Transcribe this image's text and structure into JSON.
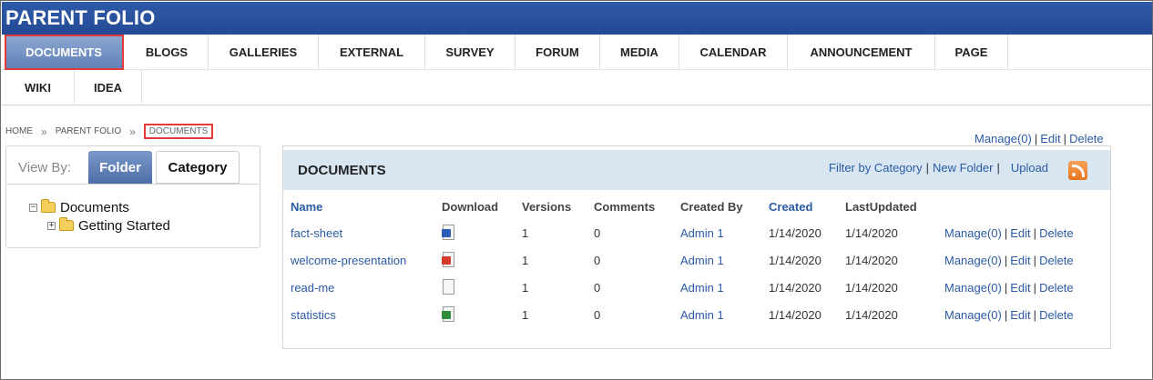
{
  "header": {
    "title": "PARENT FOLIO"
  },
  "nav": {
    "row1": [
      "DOCUMENTS",
      "BLOGS",
      "GALLERIES",
      "EXTERNAL",
      "SURVEY",
      "FORUM",
      "MEDIA",
      "CALENDAR",
      "ANNOUNCEMENT",
      "PAGE"
    ],
    "row2": [
      "WIKI",
      "IDEA"
    ],
    "active": "DOCUMENTS"
  },
  "breadcrumb": {
    "items": [
      "HOME",
      "PARENT FOLIO",
      "DOCUMENTS"
    ],
    "separator": "»"
  },
  "toplinks": {
    "manage": "Manage(0)",
    "edit": "Edit",
    "delete": "Delete",
    "separator": "|"
  },
  "viewby": {
    "label": "View By:",
    "folder": "Folder",
    "category": "Category"
  },
  "tree": {
    "root": "Documents",
    "child": "Getting Started"
  },
  "documents": {
    "title": "DOCUMENTS",
    "links": {
      "filter": "Filter by Category",
      "new_folder": "New Folder",
      "upload": "Upload"
    },
    "columns": [
      "Name",
      "Download",
      "Versions",
      "Comments",
      "Created By",
      "Created",
      "LastUpdated"
    ],
    "rows": [
      {
        "name": "fact-sheet",
        "icon": "word-file-icon",
        "versions": "1",
        "comments": "0",
        "created_by": "Admin 1",
        "created": "1/14/2020",
        "updated": "1/14/2020"
      },
      {
        "name": "welcome-presentation",
        "icon": "powerpoint-file-icon",
        "versions": "1",
        "comments": "0",
        "created_by": "Admin 1",
        "created": "1/14/2020",
        "updated": "1/14/2020"
      },
      {
        "name": "read-me",
        "icon": "text-file-icon",
        "versions": "1",
        "comments": "0",
        "created_by": "Admin 1",
        "created": "1/14/2020",
        "updated": "1/14/2020"
      },
      {
        "name": "statistics",
        "icon": "excel-file-icon",
        "versions": "1",
        "comments": "0",
        "created_by": "Admin 1",
        "created": "1/14/2020",
        "updated": "1/14/2020"
      }
    ],
    "row_actions": {
      "manage": "Manage(0)",
      "edit": "Edit",
      "delete": "Delete"
    }
  },
  "colors": {
    "header": "#2f5aa8",
    "link": "#2a5aa5",
    "panel_header": "#d8e6f2",
    "highlight": "#e03a3a"
  }
}
